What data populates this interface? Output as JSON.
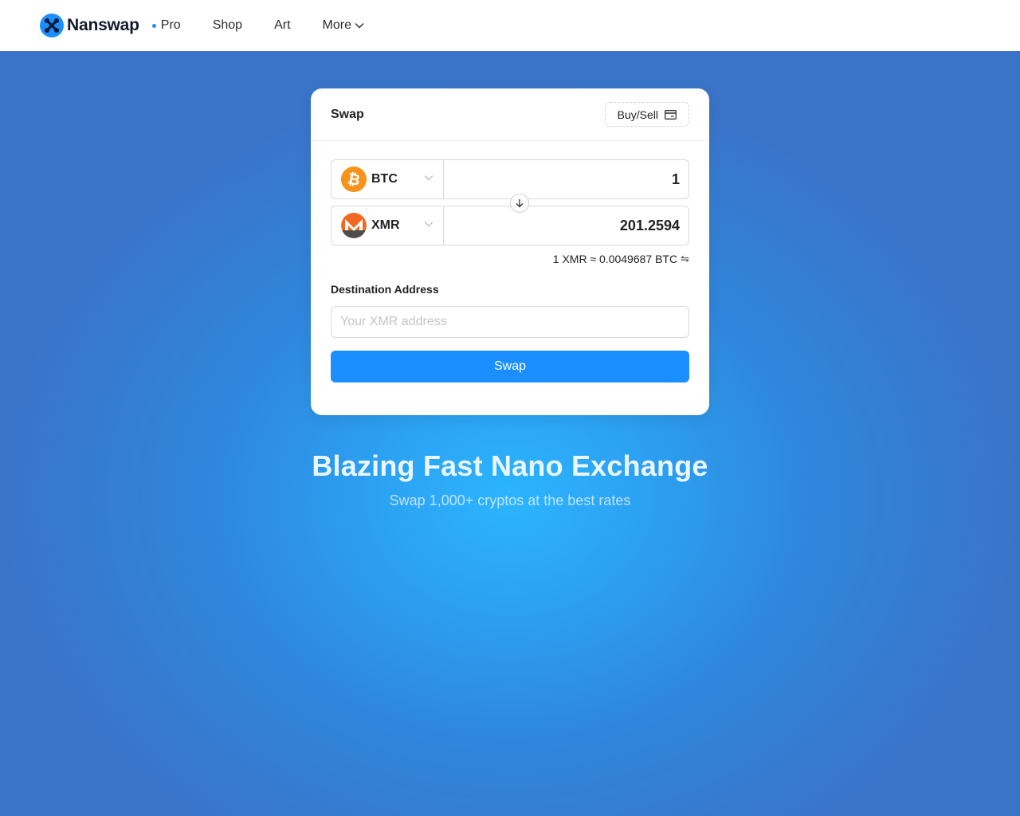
{
  "header": {
    "brand": "Nanswap",
    "pro_label": "Pro",
    "nav": {
      "shop": "Shop",
      "art": "Art",
      "more": "More"
    }
  },
  "swap_card": {
    "title": "Swap",
    "buy_sell_label": "Buy/Sell",
    "from": {
      "coin": "BTC",
      "amount": "1",
      "icon": "bitcoin-icon",
      "color": "#f7931a"
    },
    "to": {
      "coin": "XMR",
      "amount": "201.2594",
      "icon": "monero-icon",
      "color": "#f26822"
    },
    "rate_text": "1 XMR ≈ 0.0049687 BTC",
    "rate_toggle": "⇋",
    "destination_label": "Destination Address",
    "destination_placeholder": "Your XMR address",
    "swap_button": "Swap"
  },
  "hero": {
    "title": "Blazing Fast Nano Exchange",
    "subtitle": "Swap 1,000+ cryptos at the best rates"
  },
  "colors": {
    "accent": "#1b8fff",
    "background_center": "#2bb5ff",
    "background_edge": "#3a74c9"
  }
}
